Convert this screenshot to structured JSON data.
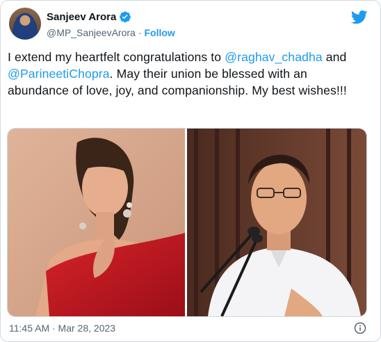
{
  "tweet": {
    "author_name": "Sanjeev Arora",
    "author_handle": "@MP_SanjeevArora",
    "separator": "·",
    "follow_label": "Follow",
    "text_part1": "I extend my heartfelt congratulations to ",
    "mention1": "@raghav_chadha",
    "text_part2": " and ",
    "mention2": "@ParineetiChopra",
    "text_part3": ". May their union be blessed with an abundance of love, joy, and companionship. My best wishes!!!",
    "timestamp": "11:45 AM · Mar 28, 2023"
  },
  "icons": {
    "verified": "verified-badge-icon",
    "brand": "twitter-bird-icon",
    "info": "info-icon"
  },
  "colors": {
    "accent": "#1d9bf0",
    "text": "#0f1419",
    "secondary": "#536471"
  }
}
